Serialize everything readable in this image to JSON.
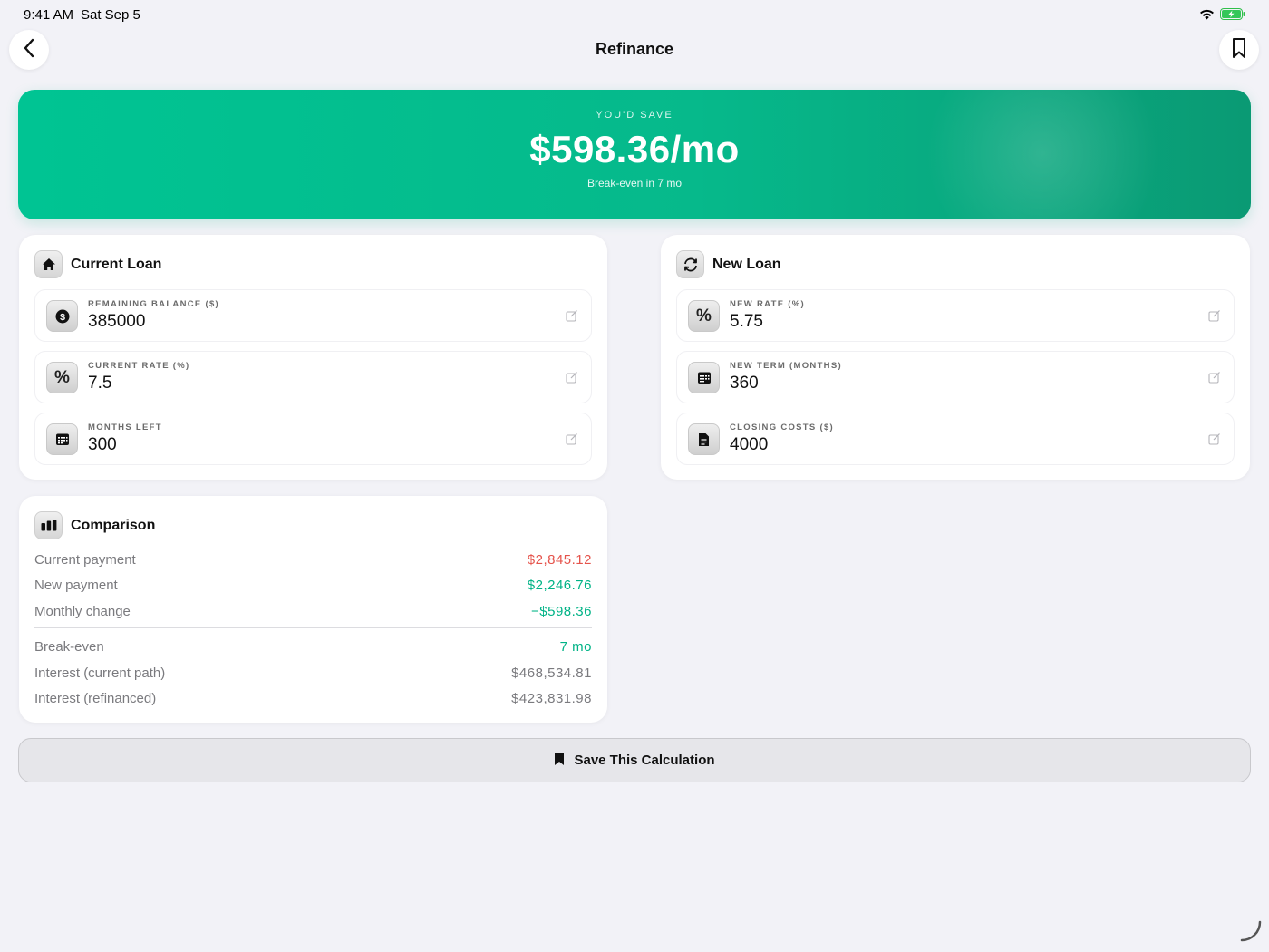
{
  "status": {
    "time": "9:41 AM",
    "date": "Sat Sep 5",
    "icons": [
      "wifi-icon",
      "battery-charging-icon"
    ]
  },
  "nav": {
    "title": "Refinance",
    "back_icon": "chevron-left-icon",
    "bookmark_icon": "bookmark-icon"
  },
  "hero": {
    "label": "YOU'D SAVE",
    "value": "$598.36/mo",
    "subtitle": "Break-even in 7 mo"
  },
  "current_loan": {
    "title": "Current Loan",
    "icon": "house-icon",
    "fields": [
      {
        "label": "REMAINING BALANCE ($)",
        "value": "385000",
        "icon": "dollar-icon"
      },
      {
        "label": "CURRENT RATE (%)",
        "value": "7.5",
        "icon": "percent-icon"
      },
      {
        "label": "MONTHS LEFT",
        "value": "300",
        "icon": "calendar-icon"
      }
    ]
  },
  "new_loan": {
    "title": "New Loan",
    "icon": "refresh-icon",
    "fields": [
      {
        "label": "NEW RATE (%)",
        "value": "5.75",
        "icon": "percent-icon"
      },
      {
        "label": "NEW TERM (MONTHS)",
        "value": "360",
        "icon": "calendar-icon"
      },
      {
        "label": "CLOSING COSTS ($)",
        "value": "4000",
        "icon": "document-icon"
      }
    ]
  },
  "comparison": {
    "title": "Comparison",
    "icon": "bar-chart-icon",
    "rows": [
      {
        "label": "Current payment",
        "value": "$2,845.12",
        "color": "#e5534b"
      },
      {
        "label": "New payment",
        "value": "$2,246.76",
        "color": "#00b386"
      },
      {
        "label": "Monthly change",
        "value": "−$598.36",
        "color": "#00b386"
      },
      {
        "label": "Break-even",
        "value": "7 mo",
        "color": "#00b386"
      },
      {
        "label": "Interest (current path)",
        "value": "$468,534.81",
        "color": "#7a7a7e"
      },
      {
        "label": "Interest (refinanced)",
        "value": "$423,831.98",
        "color": "#7a7a7e"
      }
    ]
  },
  "save_button": {
    "label": "Save This Calculation",
    "icon": "bookmark-fill-icon"
  },
  "colors": {
    "accent": "#00c493",
    "negative": "#e5534b",
    "background": "#f2f2f7"
  }
}
